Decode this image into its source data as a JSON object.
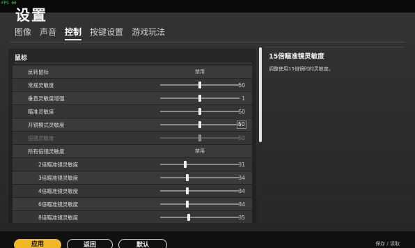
{
  "header": {
    "title": "设置"
  },
  "fps_overlay": "FPS 60",
  "tabs": [
    {
      "label": "图像"
    },
    {
      "label": "声音"
    },
    {
      "label": "控制"
    },
    {
      "label": "按键设置"
    },
    {
      "label": "游戏玩法"
    }
  ],
  "active_tab_index": 2,
  "section": {
    "title": "鼠标"
  },
  "rows": [
    {
      "label": "反转鼠标",
      "type": "toggle",
      "value": "禁用"
    },
    {
      "label": "常规灵敏度",
      "type": "slider",
      "value": "50",
      "level": 0.5
    },
    {
      "label": "垂直灵敏度增强",
      "type": "slider",
      "value": "1",
      "level": 0.5
    },
    {
      "label": "瞄准灵敏度",
      "type": "slider",
      "value": "50",
      "level": 0.5
    },
    {
      "label": "开镜模式灵敏度",
      "type": "slider-edit",
      "value": "50",
      "level": 0.5
    },
    {
      "label": "倍镜灵敏度",
      "type": "slider",
      "value": "50",
      "level": 0.5,
      "disabled": true
    },
    {
      "label": "所有倍镜灵敏度",
      "type": "toggle",
      "value": "禁用"
    },
    {
      "label": "2倍瞄准镜灵敏度",
      "type": "slider",
      "value": "31",
      "level": 0.31,
      "indent": true
    },
    {
      "label": "3倍瞄准镜灵敏度",
      "type": "slider",
      "value": "34",
      "level": 0.34,
      "indent": true
    },
    {
      "label": "4倍瞄准镜灵敏度",
      "type": "slider",
      "value": "34",
      "level": 0.34,
      "indent": true
    },
    {
      "label": "6倍瞄准镜灵敏度",
      "type": "slider",
      "value": "34",
      "level": 0.34,
      "indent": true
    },
    {
      "label": "8倍瞄准镜灵敏度",
      "type": "slider",
      "value": "35",
      "level": 0.35,
      "indent": true
    }
  ],
  "description": {
    "title": "15倍瞄准镜灵敏度",
    "text": "调整使用15倍镜时的灵敏度。"
  },
  "footer": {
    "apply_label": "应用",
    "back_label": "返回",
    "default_label": "默认",
    "hint": "保存 / 读取"
  },
  "colors": {
    "accent": "#f0b724",
    "background": "#2e2e2e"
  }
}
